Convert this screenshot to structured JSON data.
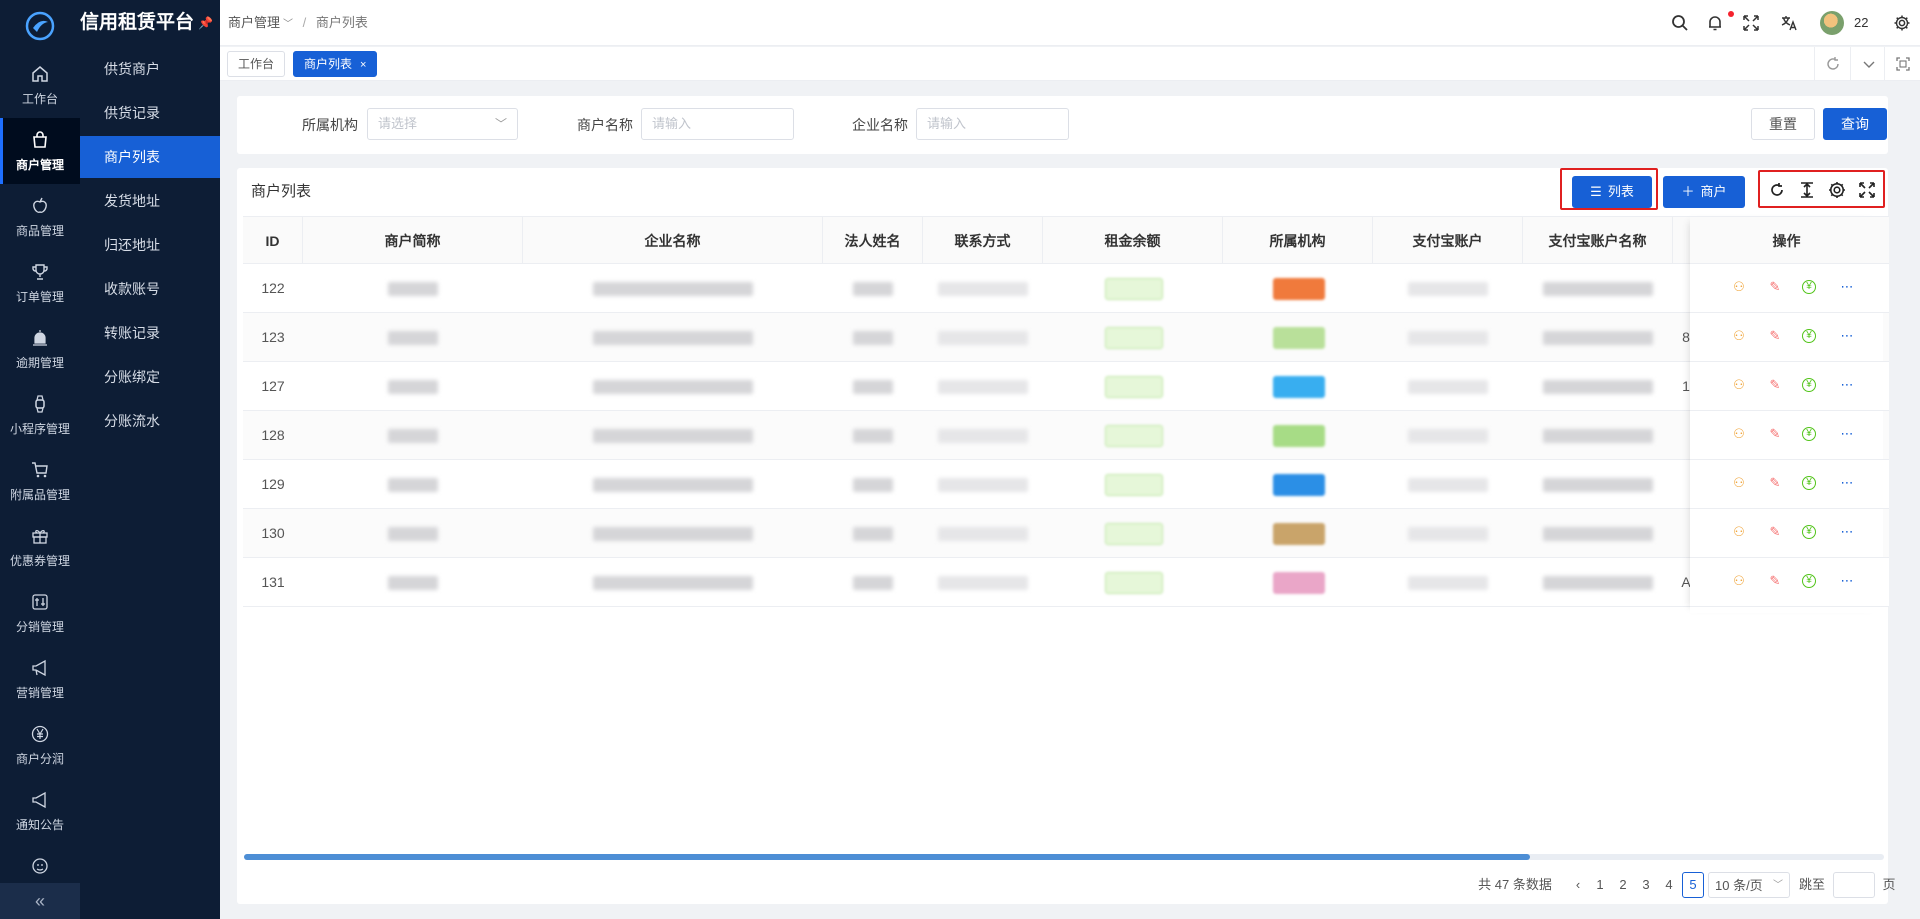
{
  "brand": {
    "title": "信用租赁平台"
  },
  "rail": {
    "items": [
      {
        "label": "工作台",
        "icon": "home-icon"
      },
      {
        "label": "商户管理",
        "icon": "shop-bag-icon",
        "active": true
      },
      {
        "label": "商品管理",
        "icon": "apple-icon"
      },
      {
        "label": "订单管理",
        "icon": "trophy-icon"
      },
      {
        "label": "逾期管理",
        "icon": "alarm-icon"
      },
      {
        "label": "小程序管理",
        "icon": "watch-icon"
      },
      {
        "label": "附属品管理",
        "icon": "cart-icon"
      },
      {
        "label": "优惠券管理",
        "icon": "gift-icon"
      },
      {
        "label": "分销管理",
        "icon": "sliders-icon"
      },
      {
        "label": "营销管理",
        "icon": "megaphone-icon"
      },
      {
        "label": "商户分润",
        "icon": "yen-circle-icon"
      },
      {
        "label": "通知公告",
        "icon": "notice-icon"
      }
    ]
  },
  "submenu": {
    "items": [
      {
        "label": "供货商户"
      },
      {
        "label": "供货记录"
      },
      {
        "label": "商户列表",
        "active": true
      },
      {
        "label": "发货地址"
      },
      {
        "label": "归还地址"
      },
      {
        "label": "收款账号"
      },
      {
        "label": "转账记录"
      },
      {
        "label": "分账绑定"
      },
      {
        "label": "分账流水"
      }
    ]
  },
  "breadcrumb": {
    "parent": "商户管理",
    "current": "商户列表"
  },
  "user": {
    "name": "22"
  },
  "tabs": [
    {
      "label": "工作台"
    },
    {
      "label": "商户列表",
      "active": true,
      "close": "×"
    }
  ],
  "filter": {
    "org_label": "所属机构",
    "org_placeholder": "请选择",
    "merchant_label": "商户名称",
    "merchant_placeholder": "请输入",
    "company_label": "企业名称",
    "company_placeholder": "请输入",
    "reset": "重置",
    "query": "查询"
  },
  "table": {
    "title": "商户列表",
    "list_btn": "列表",
    "add_btn": "商户",
    "columns": [
      "ID",
      "商户简称",
      "企业名称",
      "法人姓名",
      "联系方式",
      "租金余额",
      "所属机构",
      "支付宝账户",
      "支付宝账户名称"
    ],
    "op_column": "操作",
    "rows": [
      {
        "id": "122",
        "tag": "#f07a3c",
        "extra": ""
      },
      {
        "id": "123",
        "tag": "#b9e09a",
        "extra": "8"
      },
      {
        "id": "127",
        "tag": "#38aef0",
        "extra": "1"
      },
      {
        "id": "128",
        "tag": "#a7dc86",
        "extra": ""
      },
      {
        "id": "129",
        "tag": "#2b8fe6",
        "extra": ""
      },
      {
        "id": "130",
        "tag": "#c9a46a",
        "extra": ""
      },
      {
        "id": "131",
        "tag": "#eaa6c8",
        "extra": "A"
      }
    ]
  },
  "pager": {
    "total": "共 47 条数据",
    "pages": [
      "1",
      "2",
      "3",
      "4",
      "5"
    ],
    "current": "5",
    "size": "10 条/页",
    "jump_label": "跳至",
    "page_unit": "页"
  },
  "colors": {
    "primary": "#1760d6",
    "sidebar": "#0d1d35",
    "highlight": "#e02020"
  }
}
